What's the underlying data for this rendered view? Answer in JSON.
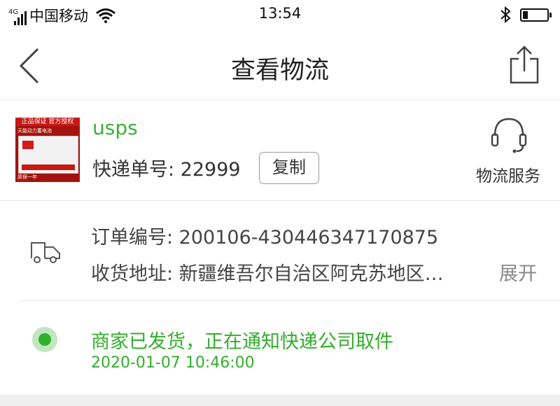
{
  "status_bar": {
    "network_type": "4G",
    "carrier": "中国移动",
    "time": "13:54",
    "battery_level": 0.2
  },
  "nav": {
    "title": "查看物流"
  },
  "express": {
    "carrier_name": "usps",
    "tracking_label": "快递单号: 22999",
    "copy_button": "复制",
    "service_label": "物流服务",
    "thumbnail": {
      "band_text": "正品保证 官方授权",
      "sub_text": "天能动力蓄电池",
      "foot_text": "质保一年"
    }
  },
  "order": {
    "order_number": "订单编号: 200106-430446347170875",
    "address": "收货地址: 新疆维吾尔自治区阿克苏地区…",
    "expand_label": "展开"
  },
  "timeline": [
    {
      "text": "商家已发货，正在通知快递公司取件",
      "time": "2020-01-07 10:46:00"
    }
  ],
  "colors": {
    "accent_green": "#3cb035",
    "text_dark": "#333333",
    "text_muted": "#888888"
  },
  "icons": [
    "signal-icon",
    "wifi-icon",
    "bluetooth-icon",
    "battery-icon",
    "back-arrow-icon",
    "share-icon",
    "headset-icon",
    "truck-icon"
  ]
}
